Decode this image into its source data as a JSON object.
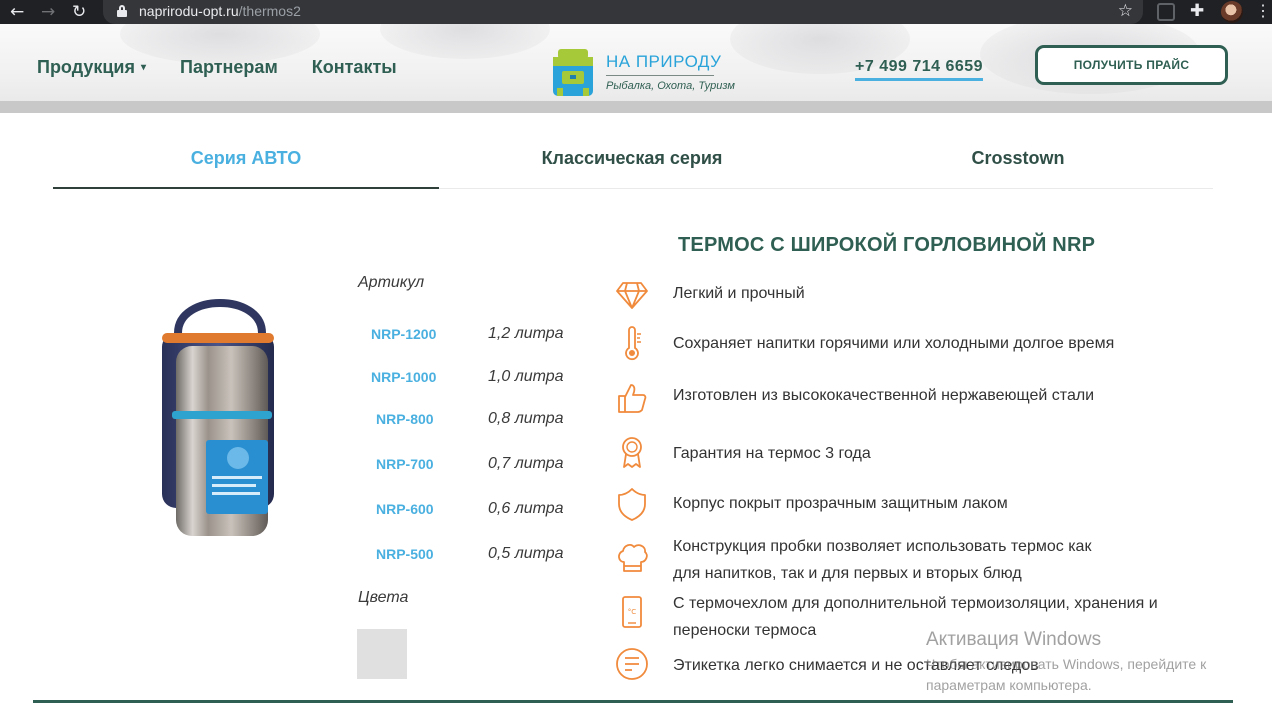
{
  "browser": {
    "url_host": "naprirodu-opt.ru",
    "url_path": "/thermos2"
  },
  "header": {
    "nav": [
      {
        "label": "Продукция",
        "has_dropdown": true
      },
      {
        "label": "Партнерам",
        "has_dropdown": false
      },
      {
        "label": "Контакты",
        "has_dropdown": false
      }
    ],
    "logo_brand": "НА ПРИРОДУ",
    "logo_tagline": "Рыбалка, Охота, Туризм",
    "phone": "+7 499 714 6659",
    "price_button": "ПОЛУЧИТЬ ПРАЙС"
  },
  "tabs": [
    {
      "label": "Серия АВТО",
      "active": true
    },
    {
      "label": "Классическая серия",
      "active": false
    },
    {
      "label": "Crosstown",
      "active": false
    }
  ],
  "product": {
    "title": "ТЕРМОС С ШИРОКОЙ ГОРЛОВИНОЙ NRP",
    "article_label": "Артикул",
    "articles": [
      {
        "sku": "NRP-1200",
        "volume": "1,2 литра"
      },
      {
        "sku": "NRP-1000",
        "volume": "1,0 литра"
      },
      {
        "sku": "NRP-800",
        "volume": "0,8 литра"
      },
      {
        "sku": "NRP-700",
        "volume": "0,7 литра"
      },
      {
        "sku": "NRP-600",
        "volume": "0,6 литра"
      },
      {
        "sku": "NRP-500",
        "volume": "0,5 литра"
      }
    ],
    "colors_label": "Цвета",
    "color_swatches": [
      "#e0e0e0"
    ],
    "features": [
      {
        "icon": "diamond-icon",
        "lines": [
          "Легкий и прочный"
        ]
      },
      {
        "icon": "thermometer-icon",
        "lines": [
          "Сохраняет напитки горячими или холодными долгое время"
        ]
      },
      {
        "icon": "thumbs-up-icon",
        "lines": [
          "Изготовлен из высококачественной нержавеющей стали"
        ]
      },
      {
        "icon": "award-icon",
        "lines": [
          "Гарантия на термос 3 года"
        ]
      },
      {
        "icon": "shield-icon",
        "lines": [
          "Корпус покрыт прозрачным защитным лаком"
        ]
      },
      {
        "icon": "chef-hat-icon",
        "lines": [
          "Конструкция пробки позволяет использовать термос как",
          "для напитков, так и для первых и вторых блюд"
        ]
      },
      {
        "icon": "phone-temp-icon",
        "lines": [
          "С термочехлом для дополнительной термоизоляции, хранения и",
          "переноски термоса"
        ]
      },
      {
        "icon": "label-icon",
        "lines": [
          "Этикетка легко снимается и не оставляет следов"
        ]
      }
    ]
  },
  "watermark": {
    "title": "Активация Windows",
    "line1": "Чтобы активировать Windows, перейдите к",
    "line2": "параметрам компьютера."
  },
  "colors": {
    "brand_green": "#2f5f52",
    "accent_blue": "#4ab0e0",
    "icon_orange": "#f08a3c"
  }
}
